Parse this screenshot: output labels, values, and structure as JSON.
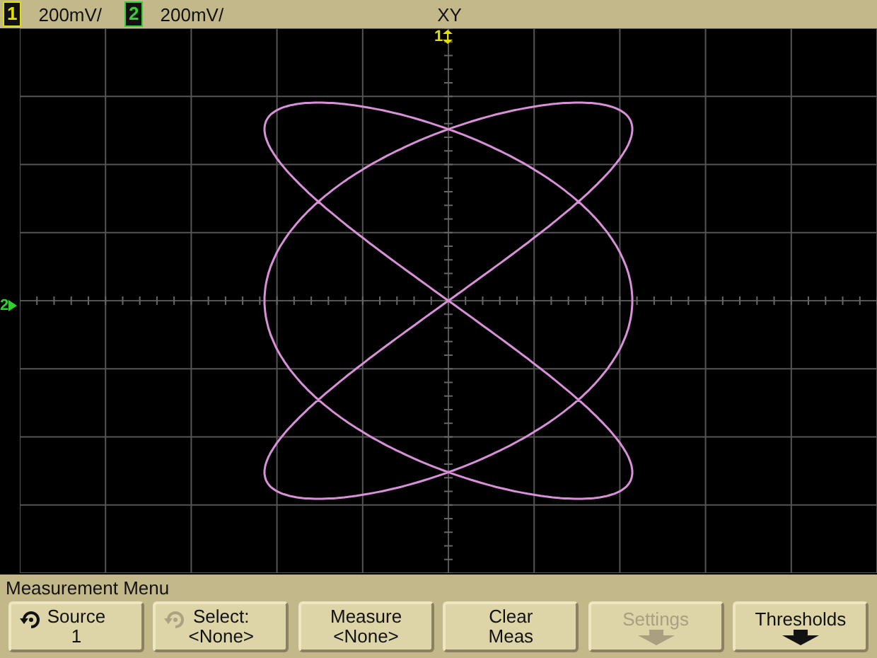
{
  "status_bar": {
    "channels": [
      {
        "label": "1",
        "scale": "200mV/",
        "color": "#e0e000"
      },
      {
        "label": "2",
        "scale": "200mV/",
        "color": "#30d030"
      }
    ],
    "mode": "XY"
  },
  "display": {
    "markers": [
      {
        "label": "1",
        "kind": "top",
        "color": "#e0e000"
      },
      {
        "label": "2",
        "kind": "left",
        "color": "#30d030"
      }
    ]
  },
  "menu": {
    "title": "Measurement Menu",
    "softkeys": [
      {
        "kind": "cycle",
        "label": "Source",
        "value": "1",
        "disabled": false,
        "icon_dimmed": false
      },
      {
        "kind": "cycle",
        "label": "Select:",
        "value": "<None>",
        "disabled": false,
        "icon_dimmed": true
      },
      {
        "kind": "plain",
        "label": "Measure",
        "value": "<None>",
        "disabled": false
      },
      {
        "kind": "plain",
        "label": "Clear",
        "value": "Meas",
        "disabled": false
      },
      {
        "kind": "submenu",
        "label": "Settings",
        "disabled": true
      },
      {
        "kind": "submenu",
        "label": "Thresholds",
        "disabled": false
      }
    ]
  }
}
